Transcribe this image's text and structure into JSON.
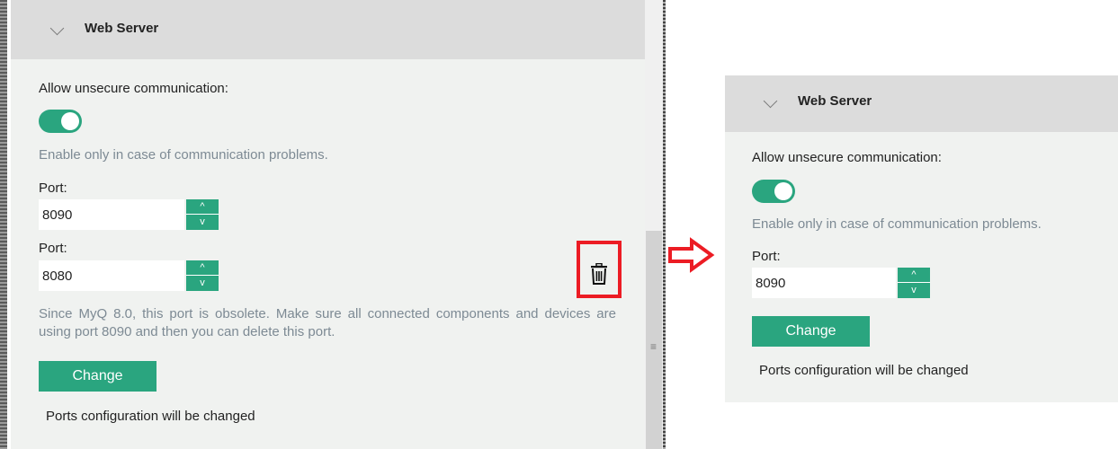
{
  "before": {
    "section_title": "Web Server",
    "allow_label": "Allow unsecure communication:",
    "allow_enabled": true,
    "hint": "Enable only in case of communication problems.",
    "port1_label": "Port:",
    "port1_value": "8090",
    "port2_label": "Port:",
    "port2_value": "8080",
    "obsolete_note": "Since MyQ 8.0, this port is obsolete. Make sure all connected components and devices are using port 8090 and then you can delete this port.",
    "change_button": "Change",
    "status": "Ports configuration will be changed"
  },
  "after": {
    "section_title": "Web Server",
    "allow_label": "Allow unsecure communication:",
    "allow_enabled": true,
    "hint": "Enable only in case of communication problems.",
    "port_label": "Port:",
    "port_value": "8090",
    "change_button": "Change",
    "status": "Ports configuration will be changed"
  },
  "spinner": {
    "up_glyph": "^",
    "down_glyph": "v"
  },
  "icons": {
    "chevron": "chevron-down-icon",
    "delete": "trash-icon",
    "transition": "arrow-right-icon",
    "grip": "scroll-grip-icon"
  },
  "colors": {
    "accent": "#2aa57f",
    "highlight": "#ec1c24",
    "hint": "#7d8a94",
    "panel_bg": "#f0f2f0",
    "header_bg": "#dcdcdc"
  }
}
